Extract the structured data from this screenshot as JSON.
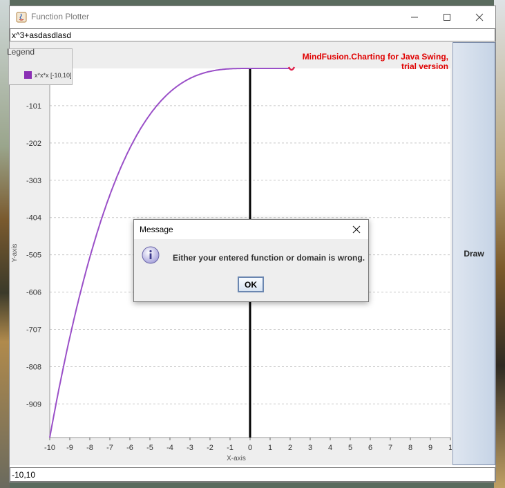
{
  "window": {
    "title": "Function Plotter",
    "minimize_glyph": "—",
    "maximize_glyph": "☐",
    "close_glyph": "✕"
  },
  "function_input": {
    "value": "x^3+asdasdlasd"
  },
  "domain_input": {
    "value": "-10,10"
  },
  "draw_button": {
    "label": "Draw"
  },
  "legend": {
    "title": "Legend",
    "items": [
      {
        "label": "x*x*x [-10,10]",
        "color": "#8a2fb4"
      }
    ]
  },
  "watermark": {
    "line1": "MindFusion.Charting for Java Swing,",
    "line2": "trial version"
  },
  "dialog": {
    "title": "Message",
    "message": "Either your entered function or domain is wrong.",
    "ok_label": "OK",
    "icon": "info-icon"
  },
  "colors": {
    "series": "#9a4fc8",
    "watermark": "#e00000",
    "accent": "#6a86b0"
  },
  "chart_data": {
    "type": "line",
    "xlabel": "X-axis",
    "ylabel": "Y-axis",
    "x_ticks": [
      "-10",
      "-9",
      "-8",
      "-7",
      "-6",
      "-5",
      "-4",
      "-3",
      "-2",
      "-1",
      "0",
      "1",
      "2",
      "3",
      "4",
      "5",
      "6",
      "7",
      "8",
      "9",
      "1"
    ],
    "y_ticks": [
      "-101",
      "-202",
      "-303",
      "-404",
      "-505",
      "-606",
      "-707",
      "-808",
      "-909"
    ],
    "xlim": [
      -10,
      10
    ],
    "ylim": [
      -1000,
      0
    ],
    "grid": true,
    "series": [
      {
        "name": "x*x*x [-10,10]",
        "function": "x^3",
        "domain": [
          -10,
          2
        ]
      }
    ]
  }
}
